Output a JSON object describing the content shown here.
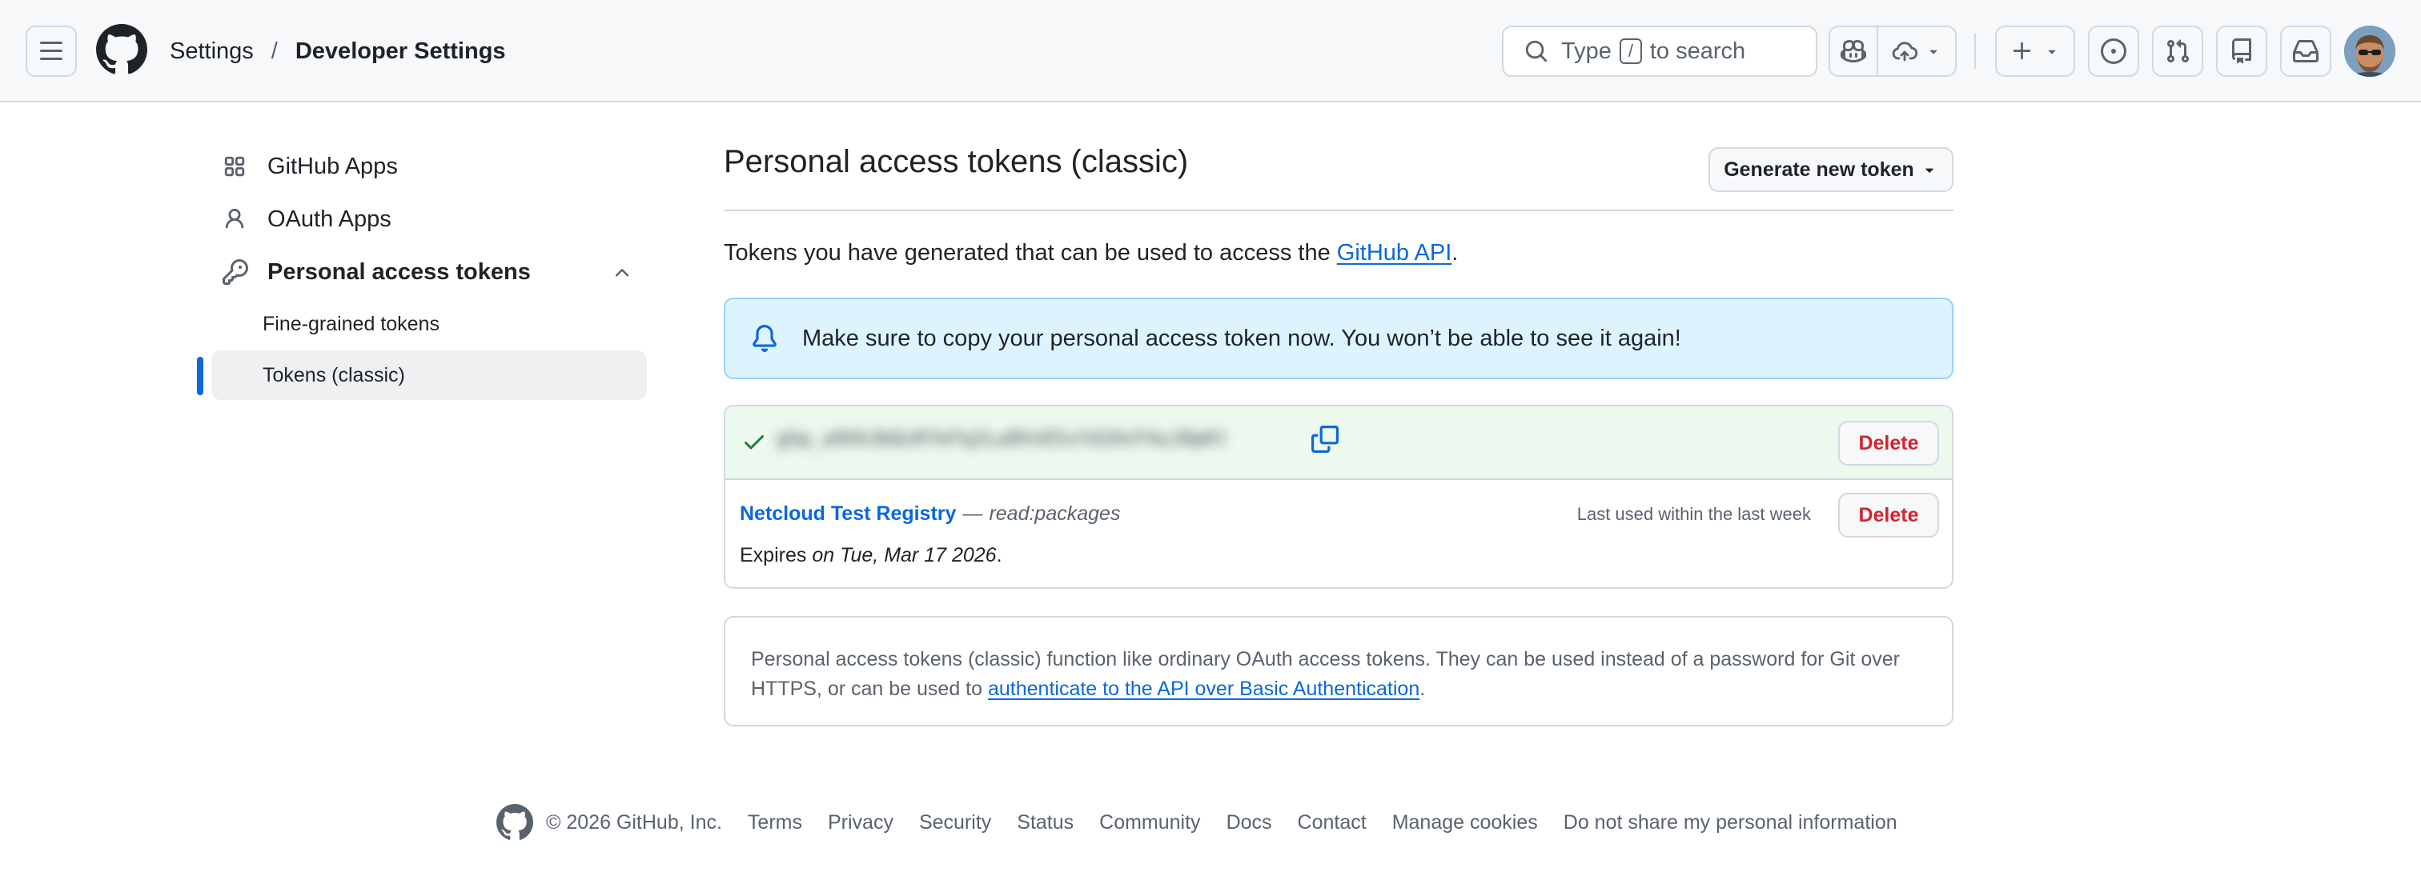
{
  "header": {
    "breadcrumb": {
      "parent": "Settings",
      "separator": "/",
      "current": "Developer Settings"
    },
    "search": {
      "prefix": "Type",
      "key": "/",
      "suffix": "to search"
    }
  },
  "sidebar": {
    "items": [
      {
        "label": "GitHub Apps",
        "icon": "apps-icon"
      },
      {
        "label": "OAuth Apps",
        "icon": "person-icon"
      },
      {
        "label": "Personal access tokens",
        "icon": "key-icon",
        "expanded": true
      }
    ],
    "sub_items": [
      {
        "label": "Fine-grained tokens",
        "active": false
      },
      {
        "label": "Tokens (classic)",
        "active": true
      }
    ]
  },
  "main": {
    "title": "Personal access tokens (classic)",
    "generate_button": "Generate new token",
    "intro_text": "Tokens you have generated that can be used to access the ",
    "intro_link": "GitHub API",
    "intro_end": ".",
    "flash_message": "Make sure to copy your personal access token now. You won’t be able to see it again!",
    "new_token": {
      "value": "ghp_a9Xk3bQzR7mTq2Lw8VnE5sYd1HcF4uJ0pKtG",
      "delete_label": "Delete"
    },
    "token": {
      "name": "Netcloud Test Registry",
      "dash": "—",
      "scope": "read:packages",
      "last_used": "Last used within the last week",
      "expires_prefix": "Expires",
      "expires_date": "on Tue, Mar 17 2026",
      "expires_end": ".",
      "delete_label": "Delete"
    },
    "info": {
      "text": "Personal access tokens (classic) function like ordinary OAuth access tokens. They can be used instead of a password for Git over HTTPS, or can be used to ",
      "link": "authenticate to the API over Basic Authentication",
      "end": "."
    }
  },
  "footer": {
    "copyright": "© 2026 GitHub, Inc.",
    "links": [
      "Terms",
      "Privacy",
      "Security",
      "Status",
      "Community",
      "Docs",
      "Contact",
      "Manage cookies",
      "Do not share my personal information"
    ]
  },
  "colors": {
    "accent": "#0969da",
    "danger": "#d1242f",
    "success": "#1a7f37",
    "flash_bg": "#ddf4ff",
    "token_bg": "#edf8ee"
  }
}
